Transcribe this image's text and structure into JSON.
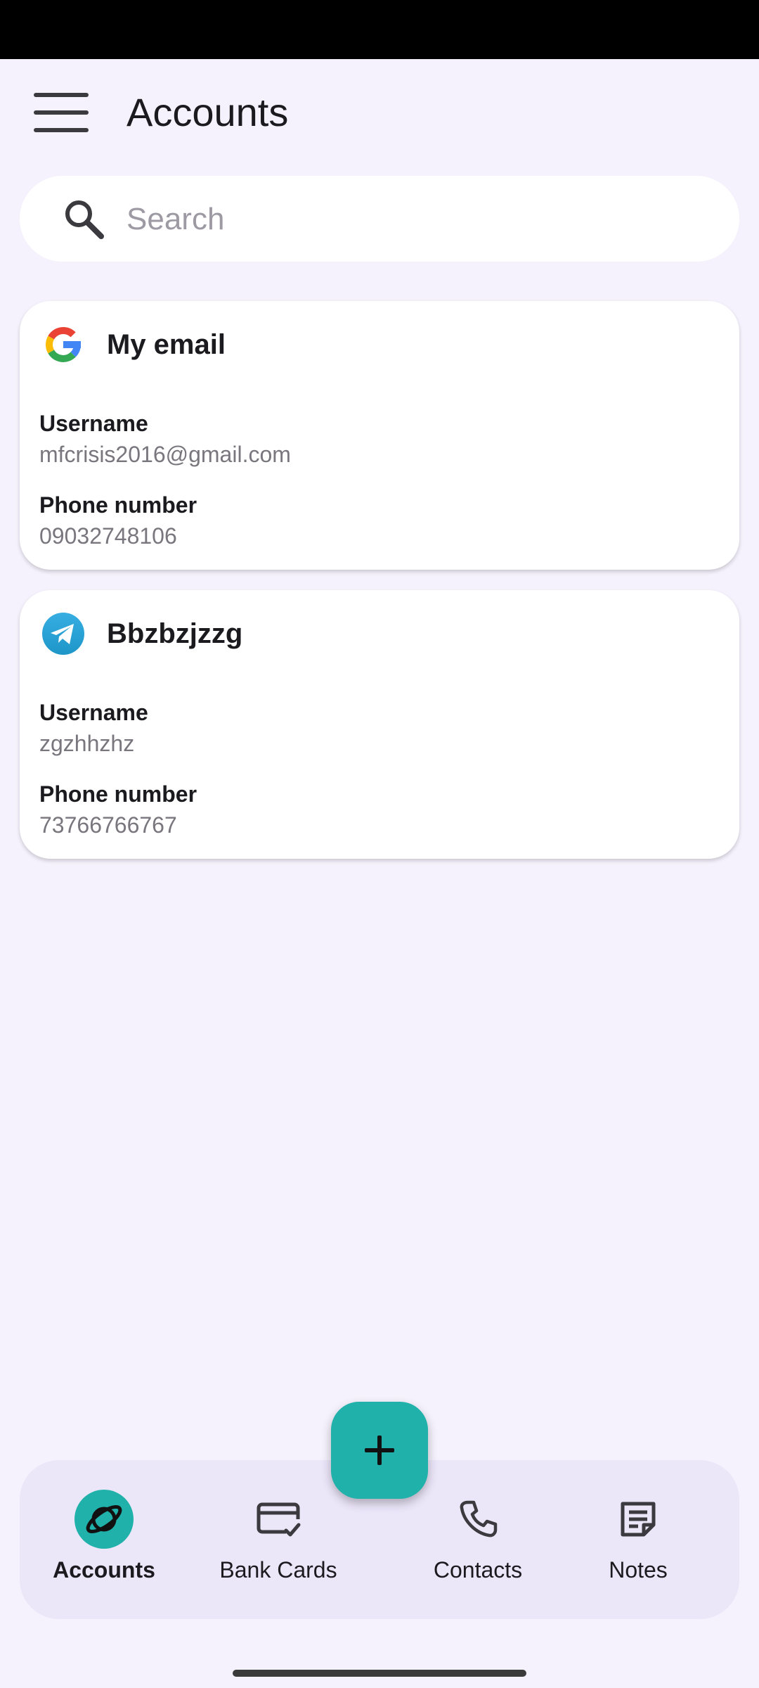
{
  "app_bar": {
    "title": "Accounts"
  },
  "search": {
    "placeholder": "Search",
    "value": ""
  },
  "accounts": [
    {
      "name": "My email",
      "icon": "google-icon",
      "username_label": "Username",
      "username": "mfcrisis2016@gmail.com",
      "phone_label": "Phone number",
      "phone": "09032748106"
    },
    {
      "name": "Bbzbzjzzg",
      "icon": "telegram-icon",
      "username_label": "Username",
      "username": "zgzhhzhz",
      "phone_label": "Phone number",
      "phone": "73766766767"
    }
  ],
  "fab": {
    "icon": "plus-icon"
  },
  "bottom_nav": {
    "items": [
      {
        "label": "Accounts",
        "icon": "planet-icon",
        "active": true
      },
      {
        "label": "Bank Cards",
        "icon": "credit-card-check-icon",
        "active": false
      },
      {
        "label": "Contacts",
        "icon": "phone-icon",
        "active": false
      },
      {
        "label": "Notes",
        "icon": "note-icon",
        "active": false
      }
    ]
  },
  "colors": {
    "accent": "#20b2aa",
    "background": "#f6f2fd",
    "nav_background": "#ece6f9",
    "card": "#ffffff",
    "secondary_text": "#79767d"
  }
}
